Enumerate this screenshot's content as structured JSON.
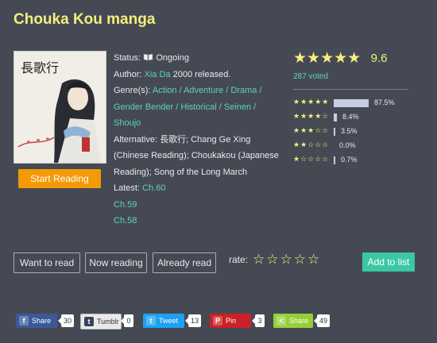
{
  "title": "Chouka Kou manga",
  "cover": {
    "title_glyphs": "長歌行",
    "alt": "cover"
  },
  "start_reading_label": "Start Reading",
  "info": {
    "status_label": "Status:",
    "status_value": "Ongoing",
    "author_label": "Author:",
    "author_name": "Xia Da",
    "author_suffix": "2000 released.",
    "genres_label": "Genre(s):",
    "genres": [
      "Action",
      "Adventure",
      "Drama",
      "Gender Bender",
      "Historical",
      "Seinen",
      "Shoujo"
    ],
    "alternative_label": "Alternative:",
    "alternative_value": "長歌行; Chang Ge Xing (Chinese Reading); Choukakou (Japanese Reading); Song of the Long March",
    "latest_label": "Latest:",
    "latest_chapters": [
      "Ch.60",
      "Ch.59",
      "Ch.58"
    ]
  },
  "rating": {
    "score": "9.6",
    "voted": "287 voted",
    "distribution": [
      {
        "stars": 5,
        "pct_text": "87.5%",
        "fraction": 0.875
      },
      {
        "stars": 4,
        "pct_text": "8.4%",
        "fraction": 0.084
      },
      {
        "stars": 3,
        "pct_text": "3.5%",
        "fraction": 0.035
      },
      {
        "stars": 2,
        "pct_text": "0.0%",
        "fraction": 0.0
      },
      {
        "stars": 1,
        "pct_text": "0.7%",
        "fraction": 0.007
      }
    ]
  },
  "lists": {
    "want": "Want to read",
    "now": "Now reading",
    "already": "Already read",
    "rate_label": "rate:",
    "add": "Add to list"
  },
  "share": [
    {
      "label": "Share",
      "count": "30",
      "icon": "facebook-icon",
      "glyph": "f",
      "color": "#3b5998"
    },
    {
      "label": "Tumblr",
      "count": "0",
      "icon": "tumblr-icon",
      "glyph": "t",
      "color": "#e9e9e9"
    },
    {
      "label": "Tweet",
      "count": "13",
      "icon": "twitter-icon",
      "glyph": "t",
      "color": "#1da1f2"
    },
    {
      "label": "Pin",
      "count": "3",
      "icon": "pinterest-icon",
      "glyph": "P",
      "color": "#cb2027"
    },
    {
      "label": "Share",
      "count": "49",
      "icon": "sharethis-icon",
      "glyph": "<",
      "color": "#95d03a"
    }
  ],
  "colors": {
    "accent_yellow": "#f4ef7a",
    "link_green": "#5fd3b5",
    "button_orange": "#f39a06",
    "add_green": "#3cc7a4",
    "background": "#454954"
  }
}
